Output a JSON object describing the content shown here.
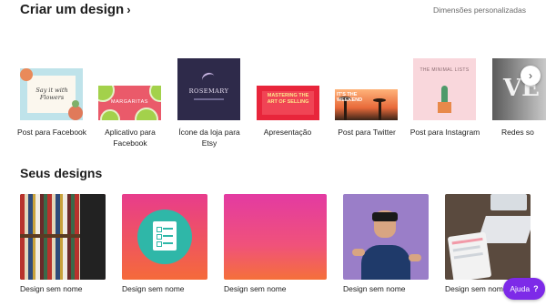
{
  "header": {
    "title": "Criar um design",
    "custom_dimensions": "Dimensões personalizadas"
  },
  "templates": [
    {
      "label": "Post para Facebook",
      "thumb_text": "Say it with Flowers"
    },
    {
      "label": "Aplicativo para Facebook",
      "thumb_text": "MARGARITAS"
    },
    {
      "label": "Ícone da loja para Etsy",
      "thumb_text": "ROSEMARY"
    },
    {
      "label": "Apresentação",
      "thumb_text": "MASTERING THE ART OF SELLING"
    },
    {
      "label": "Post para Twitter",
      "thumb_text": "IT'S THE WEEKEND"
    },
    {
      "label": "Post para Instagram",
      "thumb_text": "THE MINIMAL LISTS"
    },
    {
      "label": "Redes so",
      "thumb_text": "VE"
    }
  ],
  "my_designs": {
    "title": "Seus designs",
    "items": [
      {
        "label": "Design sem nome"
      },
      {
        "label": "Design sem nome"
      },
      {
        "label": "Design sem nome"
      },
      {
        "label": "Design sem nome"
      },
      {
        "label": "Design sem nome"
      }
    ]
  },
  "help": {
    "label": "Ajuda",
    "icon": "?"
  },
  "colors": {
    "accent": "#7d2ae8"
  }
}
